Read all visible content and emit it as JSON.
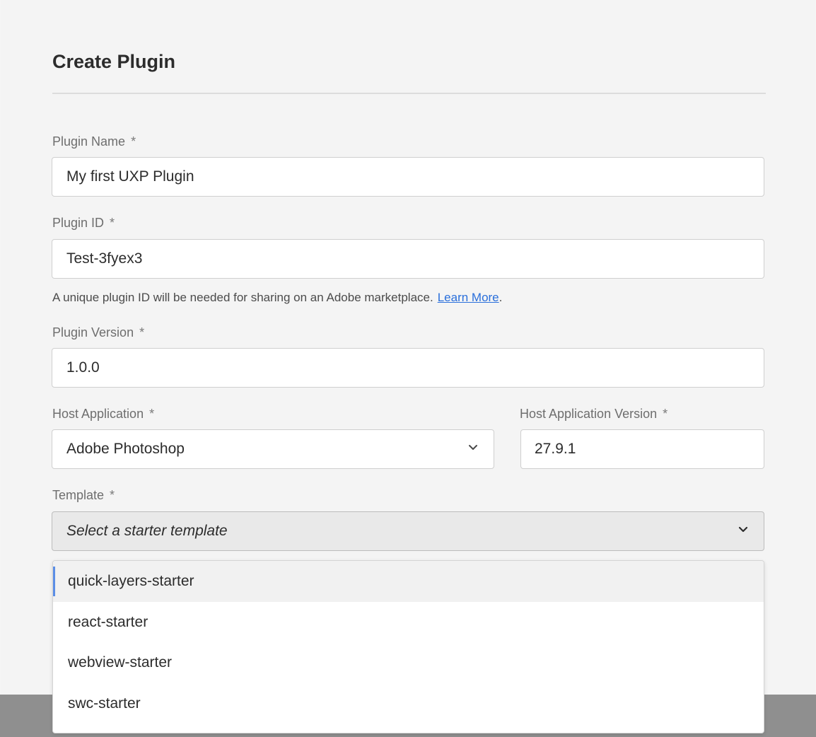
{
  "dialog": {
    "title": "Create Plugin"
  },
  "fields": {
    "plugin_name": {
      "label": "Plugin Name",
      "required_mark": "*",
      "value": "My first UXP Plugin"
    },
    "plugin_id": {
      "label": "Plugin ID",
      "required_mark": "*",
      "value": "Test-3fyex3"
    },
    "plugin_id_help": {
      "text": "A unique plugin ID will be needed for sharing on an Adobe marketplace.",
      "link": "Learn More",
      "suffix": "."
    },
    "plugin_version": {
      "label": "Plugin Version",
      "required_mark": "*",
      "value": "1.0.0"
    },
    "host_application": {
      "label": "Host Application",
      "required_mark": "*",
      "value": "Adobe Photoshop"
    },
    "host_application_version": {
      "label": "Host Application Version",
      "required_mark": "*",
      "value": "27.9.1"
    },
    "template": {
      "label": "Template",
      "required_mark": "*",
      "placeholder": "Select a starter template"
    }
  },
  "template_menu": {
    "options": [
      "quick-layers-starter",
      "react-starter",
      "webview-starter",
      "swc-starter"
    ],
    "highlighted": "quick-layers-starter"
  },
  "icons": {
    "host_application_dropdown": "chevron-down-icon",
    "template_dropdown": "chevron-down-icon"
  },
  "colors": {
    "link": "#2a6fdb",
    "highlight_bar": "#5b8ee6",
    "backdrop": "#8f8f8f"
  }
}
